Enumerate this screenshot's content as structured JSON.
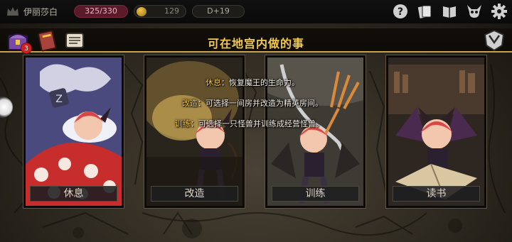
{
  "topbar": {
    "player_name": "伊丽莎白",
    "hp": "325/330",
    "gold": "129",
    "day": "D+19",
    "icons": [
      "crown-icon",
      "help-icon",
      "cards-icon",
      "book-icon",
      "demon-skull-icon",
      "settings-gear-icon"
    ]
  },
  "header": {
    "title": "可在地宫内做的事",
    "left_icons": [
      "treasure-chest-icon",
      "spellbook-icon",
      "scroll-icon"
    ],
    "chest_badge": "3",
    "right_icon": "emblem-icon"
  },
  "descriptions": [
    {
      "key": "休息",
      "text": "：恢复魔王的生命力。"
    },
    {
      "key": "改造",
      "text": "：可选择一间房并改造为精英房间。"
    },
    {
      "key": "训练",
      "text": "：可选择一只怪兽并训练成经营怪兽。"
    }
  ],
  "cards": [
    {
      "label": "休息",
      "art": "sleeping-demon-girl"
    },
    {
      "label": "改造",
      "art": "digging-demon-girl"
    },
    {
      "label": "训练",
      "art": "trident-demon-girl"
    },
    {
      "label": "读书",
      "art": "reading-demon-girl"
    }
  ],
  "colors": {
    "accent_gold": "#f2c94c",
    "hp_pill": "#5a1a2a",
    "bg_dark": "#0a0a0a"
  }
}
